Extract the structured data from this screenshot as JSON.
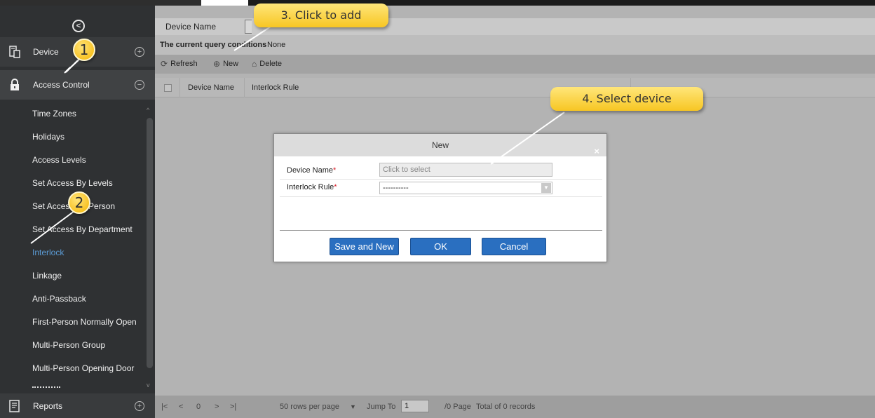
{
  "sidebar": {
    "device_label": "Device",
    "access_control_label": "Access Control",
    "reports_label": "Reports",
    "items": [
      {
        "label": "Time Zones"
      },
      {
        "label": "Holidays"
      },
      {
        "label": "Access Levels"
      },
      {
        "label": "Set Access By Levels"
      },
      {
        "label": "Set Access By Person"
      },
      {
        "label": "Set Access By Department"
      },
      {
        "label": "Interlock"
      },
      {
        "label": "Linkage"
      },
      {
        "label": "Anti-Passback"
      },
      {
        "label": "First-Person Normally Open"
      },
      {
        "label": "Multi-Person Group"
      },
      {
        "label": "Multi-Person Opening Door"
      }
    ],
    "active_item": "Interlock"
  },
  "filter": {
    "label": "Device Name"
  },
  "conditions": {
    "label": "The current query conditions",
    "value": "None"
  },
  "toolbar": {
    "refresh_label": "Refresh",
    "new_label": "New",
    "delete_label": "Delete"
  },
  "table": {
    "columns": [
      "Device Name",
      "Interlock Rule"
    ]
  },
  "pagination": {
    "first": "|<",
    "prev": "<",
    "page_value": "0",
    "next": ">",
    "last": ">|",
    "rows_per_page": "50 rows per page",
    "jump_label": "Jump To",
    "jump_value": "1",
    "page_total": "/0 Page",
    "record_total": "Total of 0 records"
  },
  "dialog": {
    "title": "New",
    "close": "×",
    "device_name_label": "Device Name",
    "device_name_placeholder": "Click to select",
    "interlock_rule_label": "Interlock Rule",
    "interlock_rule_value": "----------",
    "required_mark": "*",
    "save_new_label": "Save and New",
    "ok_label": "OK",
    "cancel_label": "Cancel"
  },
  "annotations": {
    "badge1": "1",
    "badge2": "2",
    "callout3": "3. Click to add",
    "callout4": "4. Select device"
  },
  "colors": {
    "sidebar_bg": "#2f3133",
    "active_item": "#5b9bd5",
    "primary_button": "#2a6fc0",
    "callout": "#f7c623",
    "required": "#d9232d"
  }
}
